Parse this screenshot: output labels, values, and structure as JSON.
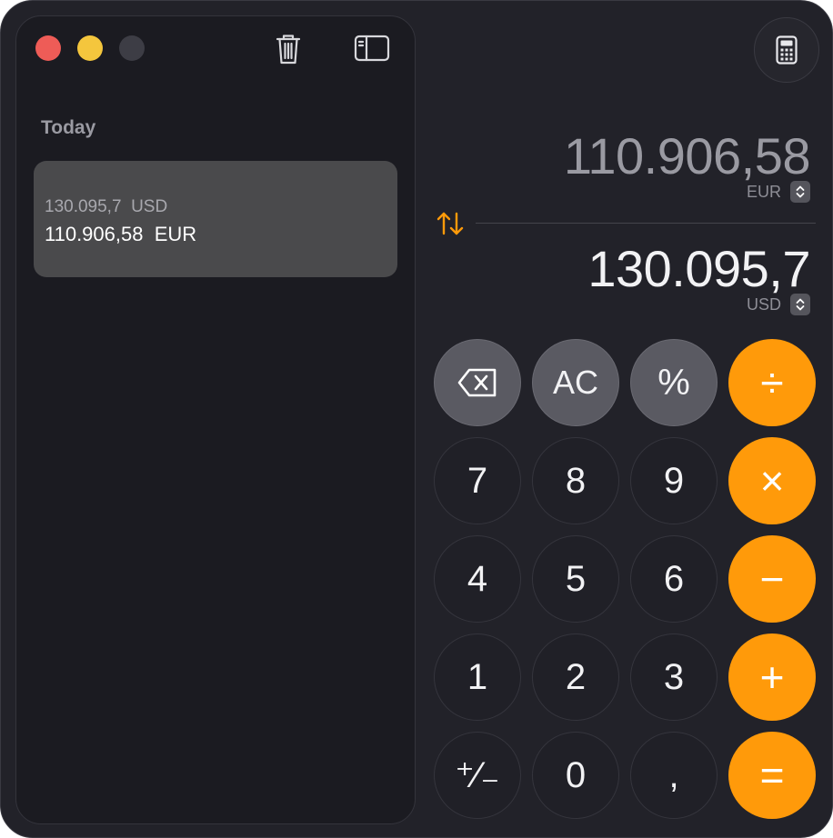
{
  "sidebar": {
    "section_title": "Today",
    "history": [
      {
        "from": "130.095,7  USD",
        "to": "110.906,58  EUR"
      }
    ]
  },
  "display": {
    "top_value": "110.906,58",
    "top_currency": "EUR",
    "bottom_value": "130.095,7",
    "bottom_currency": "USD"
  },
  "keypad": {
    "backspace": "⌫",
    "clear": "AC",
    "percent": "%",
    "divide": "÷",
    "seven": "7",
    "eight": "8",
    "nine": "9",
    "multiply": "×",
    "four": "4",
    "five": "5",
    "six": "6",
    "minus": "−",
    "one": "1",
    "two": "2",
    "three": "3",
    "plus": "+",
    "sign": "⁺∕₋",
    "zero": "0",
    "decimal": ",",
    "equals": "="
  },
  "colors": {
    "accent": "#ff9a0a",
    "window": "#222229",
    "sidebar": "#1b1b21",
    "history_row": "#4a4a4c"
  },
  "icons": [
    "trash-icon",
    "sidebar-toggle-icon",
    "calculator-icon",
    "swap-arrows-icon",
    "chevron-updown-icon",
    "backspace-icon"
  ]
}
